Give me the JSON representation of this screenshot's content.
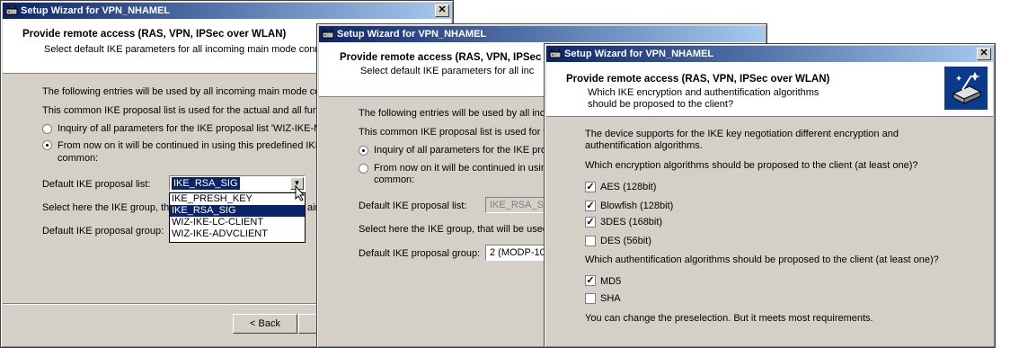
{
  "window1": {
    "title": "Setup Wizard for VPN_NHAMEL",
    "header_title": "Provide remote access (RAS, VPN, IPSec over WLAN)",
    "header_subtitle": "Select default IKE parameters for all incoming main mode connec",
    "intro_text": "The following entries will be used by all incoming main mode conn",
    "list_text": "This common IKE proposal list is used for the actual and all furthe",
    "radio1_label": "Inquiry of all parameters for the IKE proposal list 'WIZ-IKE-MA",
    "radio2_label_line1": "From now on it will be continued in using this predefined IKE p",
    "radio2_label_line2": "common:",
    "proposal_list_label": "Default IKE proposal list:",
    "proposal_list_value": "IKE_RSA_SIG",
    "dropdown_options": [
      "IKE_PRESH_KEY",
      "IKE_RSA_SIG",
      "WIZ-IKE-LC-CLIENT",
      "WIZ-IKE-ADVCLIENT"
    ],
    "group_text": "Select here the IKE group, th",
    "group_text_tail": "ain",
    "proposal_group_label": "Default IKE proposal group:",
    "back_button": "< Back",
    "radio_selected": 2
  },
  "window2": {
    "title": "Setup Wizard for VPN_NHAMEL",
    "header_title": "Provide remote access (RAS, VPN, IPSec over WLAN)",
    "header_subtitle": "Select default IKE parameters for all inc",
    "intro_text": "The following entries will be used by all inco",
    "list_text": "This common IKE proposal list is used for the",
    "radio1_label": "Inquiry of all parameters for the IKE pro",
    "radio2_label_line1": "From now on it will be continued in using",
    "radio2_label_line2": "common:",
    "proposal_list_label": "Default IKE proposal list:",
    "proposal_list_value": "IKE_RSA_SI",
    "group_text": "Select here the IKE group, that will be used",
    "proposal_group_label": "Default IKE proposal group:",
    "proposal_group_value": "2 (MODP-10",
    "radio_selected": 1
  },
  "window3": {
    "title": "Setup Wizard for VPN_NHAMEL",
    "header_title": "Provide remote access (RAS, VPN, IPSec over WLAN)",
    "header_subtitle_line1": "Which IKE encryption and authentification algorithms",
    "header_subtitle_line2": "should be proposed to the client?",
    "intro_line1": "The device supports for the IKE key negotiation different encryption and",
    "intro_line2": "authentification algorithms.",
    "encryption_question": "Which encryption algorithms should be proposed to the client (at least one)?",
    "encryption_options": [
      {
        "label": "AES (128bit)",
        "checked": true
      },
      {
        "label": "Blowfish (128bit)",
        "checked": true
      },
      {
        "label": "3DES (168bit)",
        "checked": true
      },
      {
        "label": "DES (56bit)",
        "checked": false
      }
    ],
    "auth_question": "Which authentification algorithms should be proposed to the client (at least one)?",
    "auth_options": [
      {
        "label": "MD5",
        "checked": true
      },
      {
        "label": "SHA",
        "checked": false
      }
    ],
    "footer_note": "You can change the preselection. But it meets most requirements."
  },
  "colors": {
    "titlebar_start": "#0a246a",
    "titlebar_end": "#a6caf0",
    "dialog_face": "#d4d0c8",
    "selection": "#0a246a"
  },
  "icons": {
    "app": "vpn-router-icon",
    "close": "close-icon",
    "wizard_logo": "network-wizard-icon",
    "cursor": "mouse-pointer-icon"
  }
}
